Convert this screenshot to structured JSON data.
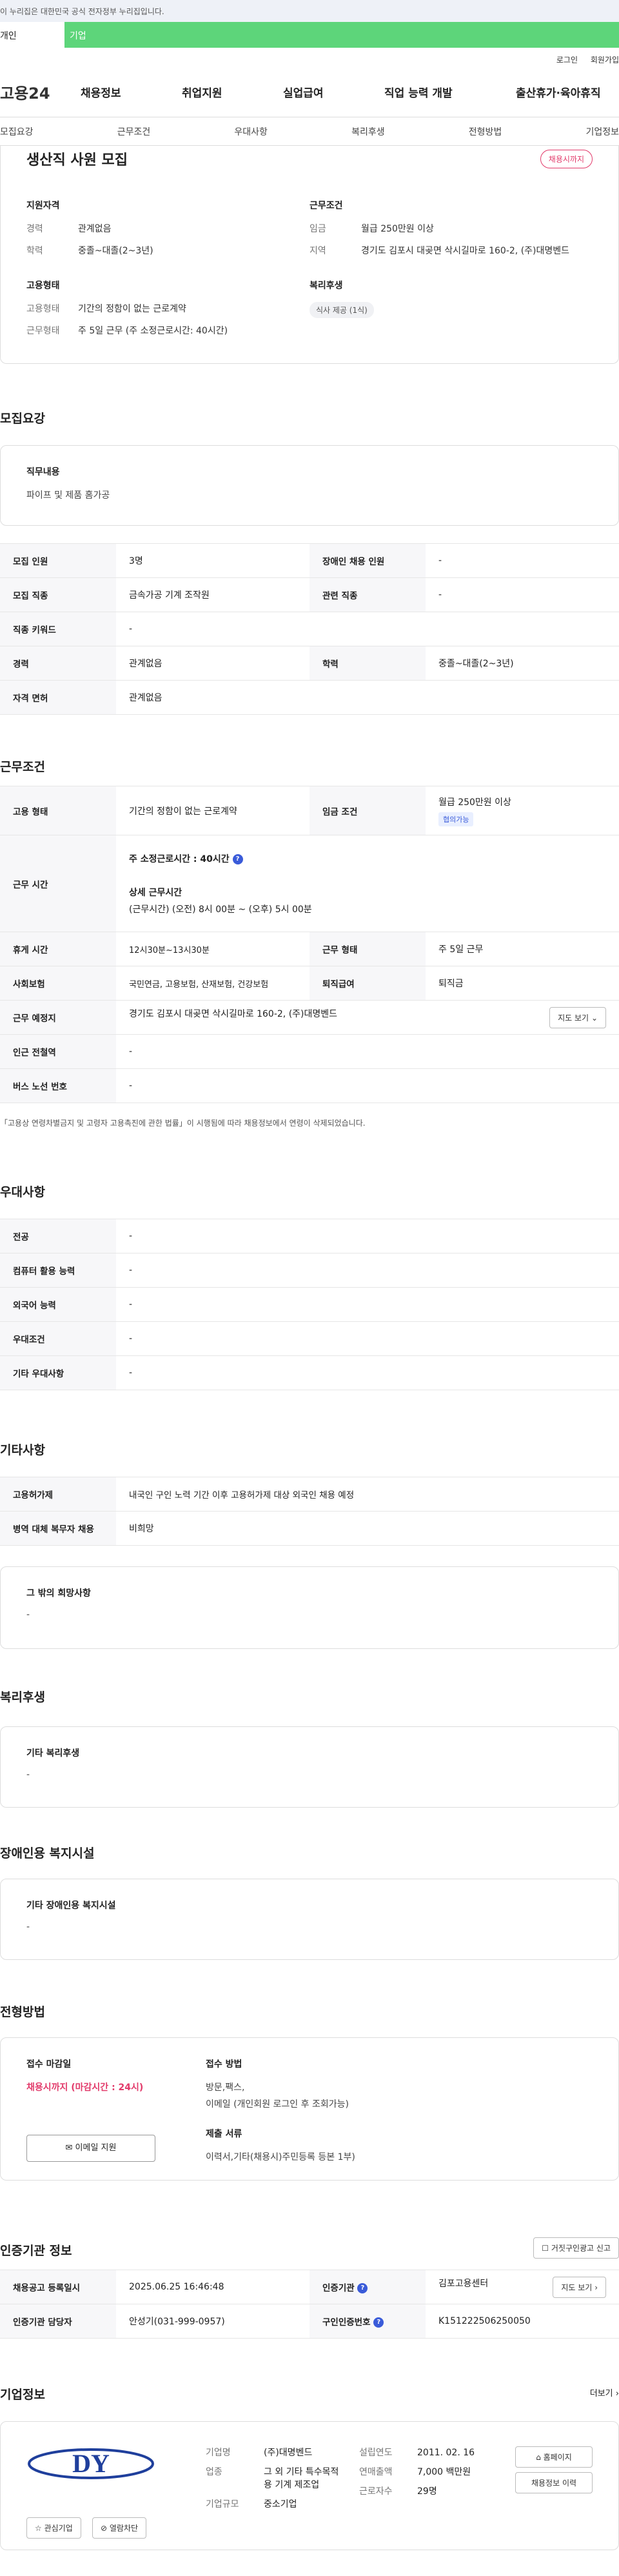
{
  "gov_bar": "이 누리집은 대한민국 공식 전자정부 누리집입니다.",
  "site_tabs": [
    "개인",
    "기업"
  ],
  "util": [
    "로그인",
    "회원가입"
  ],
  "logo": "고용24",
  "gnb": [
    "채용정보",
    "취업지원",
    "실업급여",
    "직업 능력 개발",
    "출산휴가·육아휴직"
  ],
  "subnav": [
    "모집요강",
    "근무조건",
    "우대사항",
    "복리후생",
    "전형방법",
    "기업정보"
  ],
  "header": {
    "title": "생산직 사원 모집",
    "status_badge": "채용시까지",
    "qual_title": "지원자격",
    "qual_items": [
      {
        "k": "경력",
        "v": "관계없음"
      },
      {
        "k": "학력",
        "v": "중졸~대졸(2~3년)"
      }
    ],
    "emp_title": "고용형태",
    "emp_items": [
      {
        "k": "고용형태",
        "v": "기간의 정함이 없는 근로계약"
      },
      {
        "k": "근무형태",
        "v": "주 5일 근무 (주 소정근로시간: 40시간)"
      }
    ],
    "cond_title": "근무조건",
    "cond_items": [
      {
        "k": "임금",
        "v": "월급 250만원 이상"
      },
      {
        "k": "지역",
        "v": "경기도 김포시 대곶면 삭시길마로 160-2, (주)대명벤드"
      }
    ],
    "welfare_title": "복리후생",
    "welfare_chip": "식사 제공 (1식)"
  },
  "recruit": {
    "section_title": "모집요강",
    "duty_title": "직무내용",
    "duty_value": "파이프 및 제품 홈가공",
    "rows": [
      [
        {
          "k": "모집 인원",
          "v": "3명"
        },
        {
          "k": "장애인 채용 인원",
          "v": "-"
        }
      ],
      [
        {
          "k": "모집 직종",
          "v": "금속가공 기계 조작원"
        },
        {
          "k": "관련 직종",
          "v": "-"
        }
      ],
      [
        {
          "k": "직종 키워드",
          "v": "-"
        }
      ],
      [
        {
          "k": "경력",
          "v": "관계없음"
        },
        {
          "k": "학력",
          "v": "중졸~대졸(2~3년)"
        }
      ],
      [
        {
          "k": "자격 면허",
          "v": "관계없음"
        }
      ]
    ]
  },
  "conditions": {
    "section_title": "근무조건",
    "emp_type_k": "고용 형태",
    "emp_type_v": "기간의 정함이 없는 근로계약",
    "wage_k": "임금 조건",
    "wage_v": "월급 250만원 이상",
    "wage_chip": "협의가능",
    "hours_k": "근무 시간",
    "hours_main": "주 소정근로시간 : 40시간",
    "hours_detail_title": "상세 근무시간",
    "hours_detail": "(근무시간) (오전) 8시 00분 ~ (오후) 5시 00분",
    "break_k": "휴게 시간",
    "break_v": "12시30분~13시30분",
    "work_form_k": "근무 형태",
    "work_form_v": "주 5일 근무",
    "insurance_k": "사회보험",
    "insurance_v": "국민연금, 고용보험, 산재보험, 건강보험",
    "retire_k": "퇴직급여",
    "retire_v": "퇴직금",
    "place_k": "근무 예정지",
    "place_v": "경기도 김포시 대곶면 삭시길마로 160-2, (주)대명벤드",
    "map_btn": "지도 보기",
    "station_k": "인근 전철역",
    "station_v": "-",
    "bus_k": "버스 노선 번호",
    "bus_v": "-",
    "notice": "「고용상 연령차별금지 및 고령자 고용촉진에 관한 법률」이 시행됨에 따라 채용정보에서 연령이 삭제되었습니다."
  },
  "preferences": {
    "section_title": "우대사항",
    "rows": [
      {
        "k": "전공",
        "v": "-"
      },
      {
        "k": "컴퓨터 활용 능력",
        "v": "-"
      },
      {
        "k": "외국어 능력",
        "v": "-"
      },
      {
        "k": "우대조건",
        "v": "-"
      },
      {
        "k": "기타 우대사항",
        "v": "-"
      }
    ]
  },
  "etc": {
    "section_title": "기타사항",
    "rows": [
      {
        "k": "고용허가제",
        "v": "내국인 구인 노력 기간 이후 고용허가제 대상 외국인 채용 예정"
      },
      {
        "k": "병역 대체 복무자 채용",
        "v": "비희망"
      }
    ],
    "other_title": "그 밖의 희망사항",
    "other_value": "-"
  },
  "welfare": {
    "section_title": "복리후생",
    "box_title": "기타 복리후생",
    "box_value": "-"
  },
  "disabled": {
    "section_title": "장애인용 복지시설",
    "box_title": "기타 장애인용 복지시설",
    "box_value": "-"
  },
  "screening": {
    "section_title": "전형방법",
    "deadline_title": "접수 마감일",
    "deadline_value": "채용시까지 (마감시간 : 24시)",
    "email_btn": "이메일 지원",
    "method_title": "접수 방법",
    "method_lines": [
      "방문,팩스,",
      "이메일 (개인회원 로그인 후 조회가능)"
    ],
    "docs_title": "제출 서류",
    "docs_value": "이력서,기타(채용시)주민등록 등본 1부)"
  },
  "cert": {
    "section_title": "인증기관 정보",
    "report_btn": "거짓구인광고 신고",
    "reg_k": "채용공고 등록일시",
    "reg_v": "2025.06.25 16:46:48",
    "agency_k": "인증기관",
    "agency_v": "김포고용센터",
    "map_btn": "지도 보기",
    "manager_k": "인증기관 담당자",
    "manager_v": "안성기(031-999-0957)",
    "reqno_k": "구인인증번호",
    "reqno_v": "K151222506250050"
  },
  "company": {
    "section_title": "기업정보",
    "more": "더보기",
    "logo_text": "DY",
    "fav_btn": "관심기업",
    "block_btn": "열람차단",
    "labels": {
      "name": "기업명",
      "industry": "업종",
      "size": "기업규모",
      "founded": "설립연도",
      "revenue": "연매출액",
      "employees": "근로자수"
    },
    "name": "(주)대명벤드",
    "industry": "그 외 기타 특수목적용 기계 제조업",
    "size": "중소기업",
    "founded": "2011. 02. 16",
    "revenue": "7,000 백만원",
    "employees": "29명",
    "homepage_btn": "홈페이지",
    "history_btn": "채용정보 이력"
  }
}
